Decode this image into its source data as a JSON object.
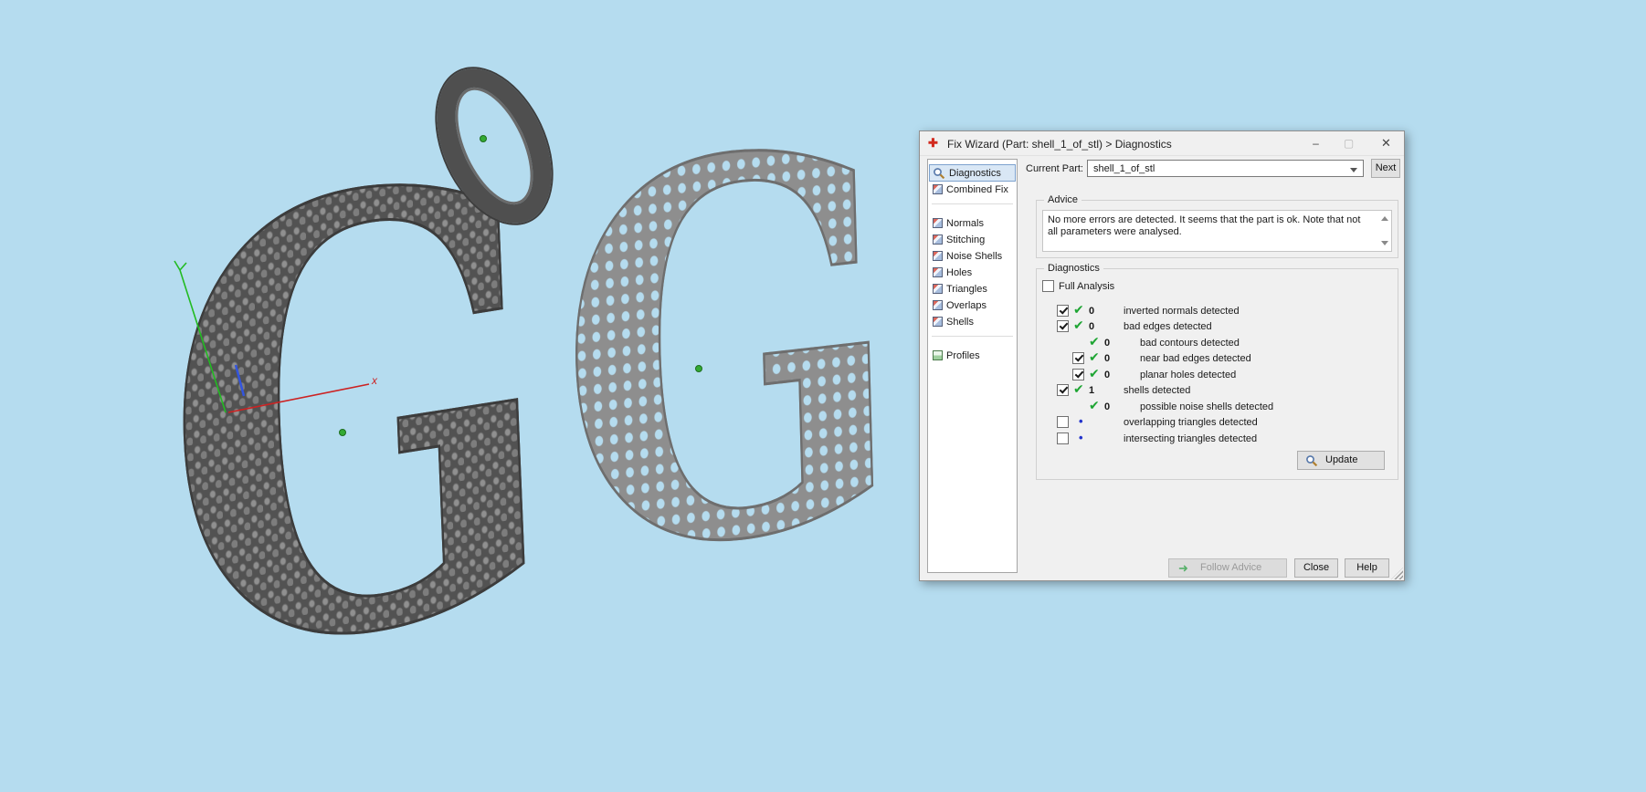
{
  "viewport": {
    "bg_color": "#b5dcef",
    "models": [
      {
        "type": "letter",
        "text": "G",
        "style": "sphere-textured pendant"
      },
      {
        "type": "letter",
        "text": "G",
        "style": "honeycomb lattice"
      },
      {
        "type": "ring",
        "style": "sphere-textured ring"
      }
    ],
    "axis_labels": {
      "x": "x"
    },
    "axis_colors": {
      "x": "#cc2222",
      "y": "#22bb22",
      "z": "#3355dd"
    },
    "origin_marker_color": "#33aa33"
  },
  "dialog": {
    "title": "Fix Wizard (Part: shell_1_of_stl) > Diagnostics",
    "window": {
      "minimize": "–",
      "maximize": "▢",
      "close": "✕"
    },
    "title_icon": "✚",
    "current_part": {
      "label": "Current Part:",
      "value": "shell_1_of_stl"
    },
    "next_button": "Next",
    "sidebar": {
      "items": [
        {
          "label": "Diagnostics",
          "icon": "magnifier-icon",
          "selected": true
        },
        {
          "label": "Combined Fix",
          "icon": "cube-icon",
          "selected": false
        },
        {
          "label": "Normals",
          "icon": "cube-icon",
          "selected": false
        },
        {
          "label": "Stitching",
          "icon": "cube-icon",
          "selected": false
        },
        {
          "label": "Noise Shells",
          "icon": "cube-icon",
          "selected": false
        },
        {
          "label": "Holes",
          "icon": "cube-icon",
          "selected": false
        },
        {
          "label": "Triangles",
          "icon": "cube-icon",
          "selected": false
        },
        {
          "label": "Overlaps",
          "icon": "cube-icon",
          "selected": false
        },
        {
          "label": "Shells",
          "icon": "cube-icon",
          "selected": false
        },
        {
          "label": "Profiles",
          "icon": "profiles-icon",
          "selected": false
        }
      ]
    },
    "advice": {
      "title": "Advice",
      "text": "No more errors are detected. It seems that the part is ok. Note that not all parameters were analysed."
    },
    "icons": {
      "check": "✔",
      "dot": "•"
    },
    "diagnostics": {
      "title": "Diagnostics",
      "full_analysis": {
        "label": "Full Analysis",
        "checked": false
      },
      "rows": [
        {
          "checkbox": true,
          "checked": true,
          "status": "check",
          "count": "0",
          "label": "inverted normals detected",
          "indent": 0
        },
        {
          "checkbox": true,
          "checked": true,
          "status": "check",
          "count": "0",
          "label": "bad edges detected",
          "indent": 0
        },
        {
          "checkbox": false,
          "checked": false,
          "status": "check",
          "count": "0",
          "label": "bad contours detected",
          "indent": 1
        },
        {
          "checkbox": true,
          "checked": true,
          "status": "check",
          "count": "0",
          "label": "near bad edges detected",
          "indent": 1
        },
        {
          "checkbox": true,
          "checked": true,
          "status": "check",
          "count": "0",
          "label": "planar holes detected",
          "indent": 1
        },
        {
          "checkbox": true,
          "checked": true,
          "status": "check",
          "count": "1",
          "label": "shells detected",
          "indent": 0
        },
        {
          "checkbox": false,
          "checked": false,
          "status": "check",
          "count": "0",
          "label": "possible noise shells detected",
          "indent": 1
        },
        {
          "checkbox": true,
          "checked": false,
          "status": "dot",
          "count": "",
          "label": "overlapping triangles detected",
          "indent": 0
        },
        {
          "checkbox": true,
          "checked": false,
          "status": "dot",
          "count": "",
          "label": "intersecting triangles detected",
          "indent": 0
        }
      ],
      "update_button": "Update"
    },
    "footer": {
      "follow_advice": "Follow Advice",
      "follow_advice_enabled": false,
      "close": "Close",
      "help": "Help"
    },
    "status_colors": {
      "ok_green": "#1ea533",
      "info_blue": "#2233cc"
    }
  }
}
